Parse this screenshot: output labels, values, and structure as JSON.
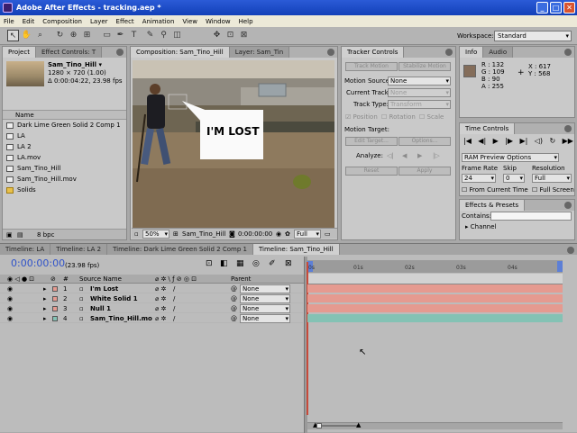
{
  "window": {
    "title": "Adobe After Effects - tracking.aep *",
    "min": "_",
    "max": "□",
    "close": "✕"
  },
  "menu": [
    "File",
    "Edit",
    "Composition",
    "Layer",
    "Effect",
    "Animation",
    "View",
    "Window",
    "Help"
  ],
  "workspace": {
    "label": "Workspace:",
    "value": "Standard"
  },
  "project_panel": {
    "tabs": [
      "Project",
      "Effect Controls: T"
    ],
    "footage_name": "Sam_Tino_Hill ▾",
    "footage_res": "1280 × 720 (1.00)",
    "footage_dur": "Δ 0:00:04:22, 23.98 fps",
    "col_name": "Name",
    "items": [
      "Dark Lime Green Solid 2 Comp 1",
      "LA",
      "LA 2",
      "LA.mov",
      "Sam_Tino_Hill",
      "Sam_Tino_Hill.mov",
      "Solids"
    ],
    "bpc": "8 bpc"
  },
  "comp_panel": {
    "tab": "Composition: Sam_Tino_Hill",
    "tab2": "Layer: Sam_Tin",
    "bubble_text": "I'M LOST",
    "zoom": "50%",
    "comp_name": "Sam_Tino_Hill",
    "timecode": "0:00:00:00",
    "quality": "Full"
  },
  "tracker": {
    "title": "Tracker Controls",
    "track_motion": "Track Motion",
    "stabilize_motion": "Stabilize Motion",
    "motion_source_label": "Motion Source:",
    "motion_source": "None",
    "current_track_label": "Current Track:",
    "current_track": "None",
    "track_type_label": "Track Type:",
    "track_type": "Transform",
    "position": "Position",
    "rotation": "Rotation",
    "scale": "Scale",
    "motion_target_label": "Motion Target:",
    "edit_target": "Edit Target...",
    "options": "Options...",
    "analyze_label": "Analyze:",
    "reset": "Reset",
    "apply": "Apply"
  },
  "info": {
    "tabs": [
      "Info",
      "Audio"
    ],
    "r": "R : 132",
    "g": "G : 109",
    "b": "B : 90",
    "a": "A : 255",
    "x": "X : 617",
    "y": "Y : 568",
    "swatch": "#846d5a"
  },
  "time_controls": {
    "title": "Time Controls",
    "ram": "RAM Preview Options",
    "frame_rate_label": "Frame Rate",
    "frame_rate": "24",
    "skip_label": "Skip",
    "skip": "0",
    "resolution_label": "Resolution",
    "resolution": "Full",
    "from_current": "From Current Time",
    "full_screen": "Full Screen"
  },
  "effects": {
    "title": "Effects & Presets",
    "contains": "Contains:",
    "channel": "Channel"
  },
  "timeline": {
    "tabs": [
      "Timeline: LA",
      "Timeline: LA 2",
      "Timeline: Dark Lime Green Solid 2 Comp 1",
      "Timeline: Sam_Tino_Hill"
    ],
    "timecode": "0:00:00:00",
    "fps": "(23.98 fps)",
    "col_num": "#",
    "col_source": "Source Name",
    "col_parent": "Parent",
    "ruler": [
      "0s",
      "01s",
      "02s",
      "03s",
      "04s"
    ],
    "layers": [
      {
        "num": "1",
        "name": "I'm Lost",
        "parent": "None",
        "color": "#e59a90"
      },
      {
        "num": "2",
        "name": "White Solid 1",
        "parent": "None",
        "color": "#e59a90"
      },
      {
        "num": "3",
        "name": "Null 1",
        "parent": "None",
        "color": "#e59a90"
      },
      {
        "num": "4",
        "name": "Sam_Tino_Hill.mo",
        "parent": "None",
        "color": "#84c2b4"
      }
    ]
  }
}
